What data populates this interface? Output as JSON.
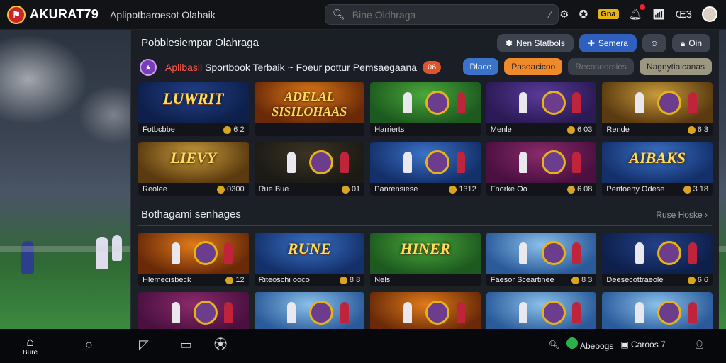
{
  "topbar": {
    "brand": "AKURAT79",
    "subtitle": "Aplipotbaroesot Olabaik",
    "search_placeholder": "Bine Oldhraga",
    "odds_chip": "Gna",
    "user_status": "Œ3"
  },
  "header": {
    "title": "Pobblesiempar Olahraga",
    "buttons": [
      "Nen Statbols",
      "Semera",
      "",
      "Oin"
    ]
  },
  "promo": {
    "text_highlight": "Aplibasil",
    "text": " Sportbook Terbaik ~ Foeur pottur Pemsaegaana",
    "badge": "06"
  },
  "filters": [
    "Dlace",
    "Pasoacicoo",
    "Recosoorsies",
    "Nagnytiaicanas"
  ],
  "featured": [
    {
      "title": "Fotbcbbe",
      "odds": "6 2",
      "art": "LUWRIT",
      "theme": "navy"
    },
    {
      "title": "",
      "odds": "",
      "art": "ADELAL SISILOHAAS",
      "theme": "orange"
    },
    {
      "title": "Harrierts",
      "odds": "",
      "art": "",
      "theme": "green"
    },
    {
      "title": "Menle",
      "odds": "6 03",
      "art": "",
      "theme": "purple"
    },
    {
      "title": "Rende",
      "odds": "6 3",
      "art": "",
      "theme": "gold"
    },
    {
      "title": "Reolee",
      "odds": "0300",
      "art": "LIEVY",
      "theme": "gold"
    },
    {
      "title": "Rue Bue",
      "odds": "01",
      "art": "",
      "theme": "dark"
    },
    {
      "title": "Panrensiese",
      "odds": "1312",
      "art": "",
      "theme": "blue"
    },
    {
      "title": "Fnorke Oo",
      "odds": "6 08",
      "art": "",
      "theme": "magenta"
    },
    {
      "title": "Penfoeny Odese",
      "odds": "3 18",
      "art": "AIBAKS",
      "theme": "blue"
    }
  ],
  "section": {
    "title": "Bothagami senhages",
    "see_all": "Ruse Hoske"
  },
  "more": [
    {
      "title": "Hlemecisbeck",
      "odds": "12",
      "art": "",
      "theme": "orange"
    },
    {
      "title": "Riteoschi ooco",
      "odds": "8 8",
      "art": "RUNE",
      "theme": "blue"
    },
    {
      "title": "Nels",
      "odds": "",
      "art": "HINER",
      "theme": "green"
    },
    {
      "title": "Faesor Sceartinee",
      "odds": "8 3",
      "art": "",
      "theme": "sky"
    },
    {
      "title": "Deesecottraeole",
      "odds": "6 6",
      "art": "",
      "theme": "navy"
    },
    {
      "title": "",
      "odds": "",
      "art": "",
      "theme": "magenta"
    },
    {
      "title": "",
      "odds": "",
      "art": "",
      "theme": "sky"
    },
    {
      "title": "",
      "odds": "",
      "art": "",
      "theme": "orange"
    },
    {
      "title": "",
      "odds": "",
      "art": "",
      "theme": "sky"
    },
    {
      "title": "",
      "odds": "",
      "art": "",
      "theme": "sky"
    }
  ],
  "bottomnav": {
    "home": "Bure",
    "search_label": "Abeoogs",
    "user_label": "Caroos",
    "user_count": "7"
  }
}
